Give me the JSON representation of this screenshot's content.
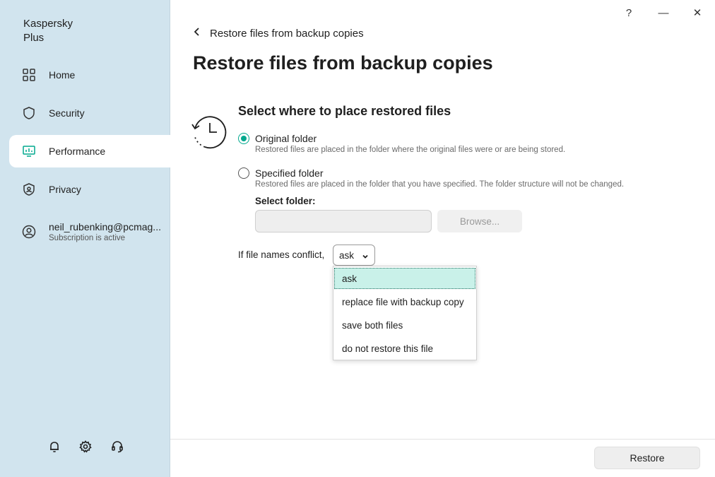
{
  "sidebar": {
    "app_title_line1": "Kaspersky",
    "app_title_line2": "Plus",
    "items": [
      {
        "label": "Home",
        "icon": "grid-icon"
      },
      {
        "label": "Security",
        "icon": "shield-icon"
      },
      {
        "label": "Performance",
        "icon": "monitor-gauge-icon",
        "active": true
      },
      {
        "label": "Privacy",
        "icon": "privacy-shield-icon"
      }
    ],
    "account": {
      "name": "neil_rubenking@pcmag...",
      "status": "Subscription is active"
    },
    "bottom_icons": [
      "bell-icon",
      "gear-icon",
      "headset-icon"
    ]
  },
  "window_controls": {
    "help": "?",
    "minimize": "—",
    "close": "✕"
  },
  "header": {
    "back_label": "Restore files from backup copies",
    "page_title": "Restore files from backup copies"
  },
  "section": {
    "title": "Select where to place restored files",
    "options": [
      {
        "label": "Original folder",
        "description": "Restored files are placed in the folder where the original files were or are being stored.",
        "checked": true
      },
      {
        "label": "Specified folder",
        "description": "Restored files are placed in the folder that you have specified. The folder structure will not be changed.",
        "checked": false
      }
    ],
    "select_folder_label": "Select folder:",
    "folder_value": "",
    "browse_label": "Browse..."
  },
  "conflict": {
    "label": "If file names conflict,",
    "selected": "ask",
    "options": [
      "ask",
      "replace file with backup copy",
      "save both files",
      "do not restore this file"
    ]
  },
  "footer": {
    "restore_label": "Restore"
  },
  "colors": {
    "sidebar_bg": "#d1e4ee",
    "accent": "#00a88e",
    "selected_option_bg": "#c9f1e9"
  }
}
